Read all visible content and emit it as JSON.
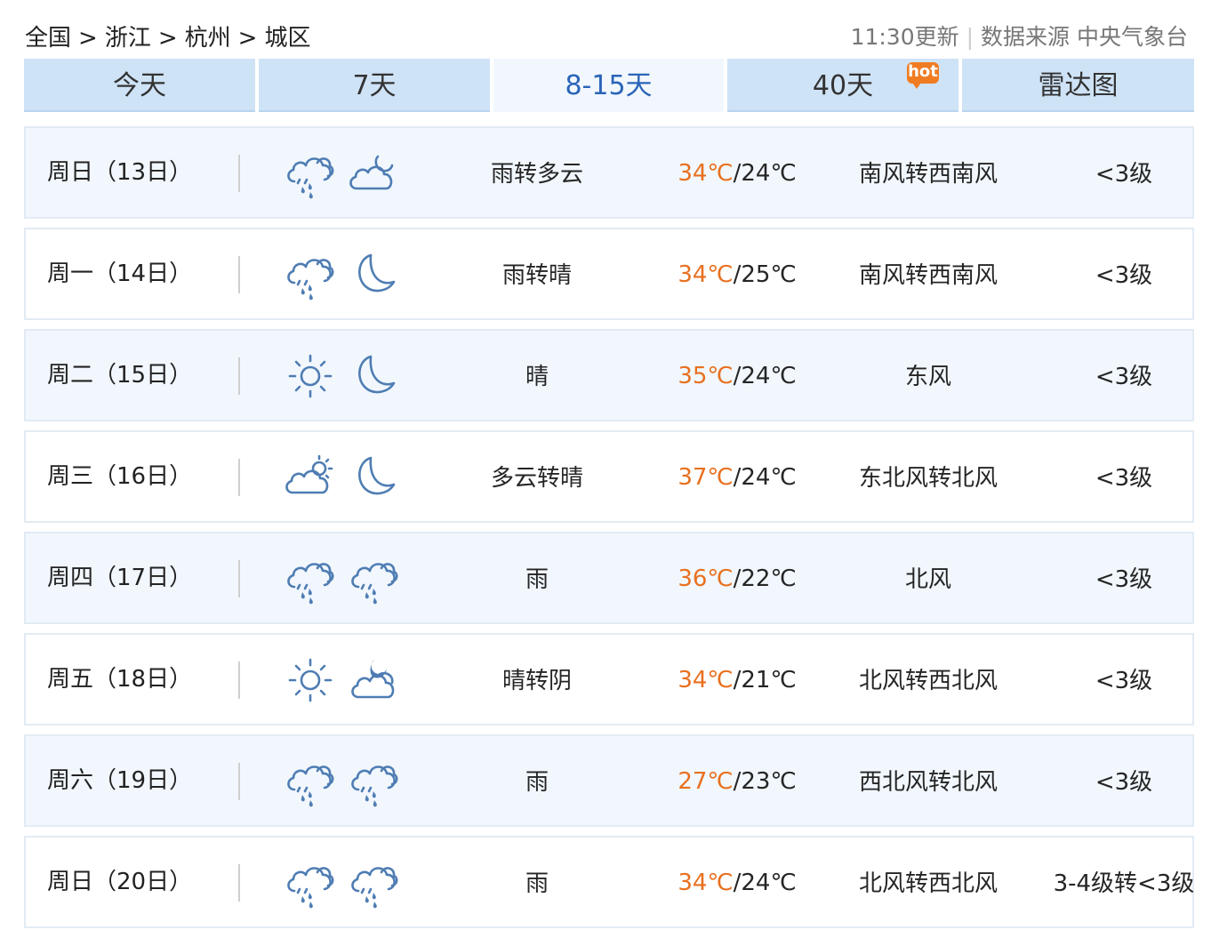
{
  "breadcrumb": {
    "items": [
      "全国",
      "浙江",
      "杭州",
      "城区"
    ],
    "separator": ">"
  },
  "meta": {
    "update_time": "11:30更新",
    "source": "数据来源 中央气象台"
  },
  "tabs": [
    {
      "label": "今天",
      "active": false
    },
    {
      "label": "7天",
      "active": false
    },
    {
      "label": "8-15天",
      "active": true
    },
    {
      "label": "40天",
      "active": false,
      "badge": "hot"
    },
    {
      "label": "雷达图",
      "active": false
    }
  ],
  "colors": {
    "accent": "#2a64b8",
    "high_temp": "#e8701f",
    "tab_bg": "#cfe3f7",
    "row_alt": "#f1f7fd",
    "icon": "#4f7db3",
    "hot_badge": "#f07c22"
  },
  "forecast": [
    {
      "date": "周日（13日）",
      "icon_day": "rain-cloud-icon",
      "icon_night": "moon-cloud-icon",
      "desc": "雨转多云",
      "high": "34℃",
      "low": "24℃",
      "wind": "南风转西南风",
      "level": "<3级"
    },
    {
      "date": "周一（14日）",
      "icon_day": "rain-cloud-icon",
      "icon_night": "moon-icon",
      "desc": "雨转晴",
      "high": "34℃",
      "low": "25℃",
      "wind": "南风转西南风",
      "level": "<3级"
    },
    {
      "date": "周二（15日）",
      "icon_day": "sun-icon",
      "icon_night": "moon-icon",
      "desc": "晴",
      "high": "35℃",
      "low": "24℃",
      "wind": "东风",
      "level": "<3级"
    },
    {
      "date": "周三（16日）",
      "icon_day": "sun-cloud-icon",
      "icon_night": "moon-icon",
      "desc": "多云转晴",
      "high": "37℃",
      "low": "24℃",
      "wind": "东北风转北风",
      "level": "<3级"
    },
    {
      "date": "周四（17日）",
      "icon_day": "rain-cloud-icon",
      "icon_night": "rain-cloud-icon",
      "desc": "雨",
      "high": "36℃",
      "low": "22℃",
      "wind": "北风",
      "level": "<3级"
    },
    {
      "date": "周五（18日）",
      "icon_day": "sun-icon",
      "icon_night": "moon-overcast-icon",
      "desc": "晴转阴",
      "high": "34℃",
      "low": "21℃",
      "wind": "北风转西北风",
      "level": "<3级"
    },
    {
      "date": "周六（19日）",
      "icon_day": "rain-cloud-icon",
      "icon_night": "rain-cloud-icon",
      "desc": "雨",
      "high": "27℃",
      "low": "23℃",
      "wind": "西北风转北风",
      "level": "<3级"
    },
    {
      "date": "周日（20日）",
      "icon_day": "rain-cloud-icon",
      "icon_night": "rain-cloud-icon",
      "desc": "雨",
      "high": "34℃",
      "low": "24℃",
      "wind": "北风转西北风",
      "level": "3-4级转<3级"
    }
  ]
}
